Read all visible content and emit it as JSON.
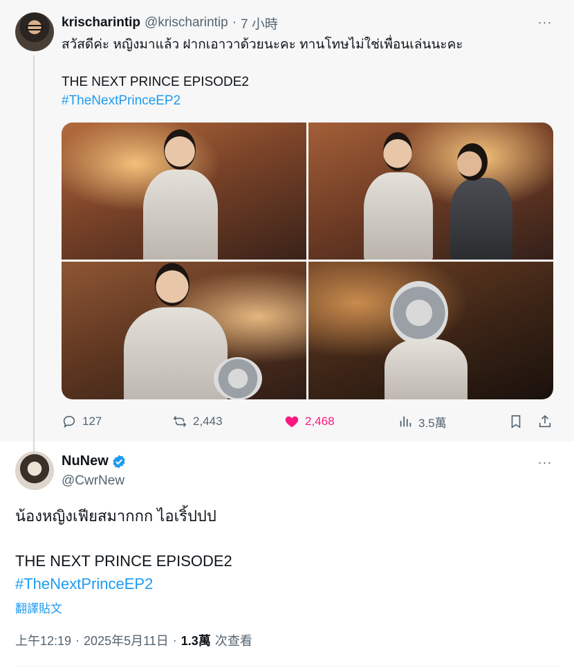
{
  "parent_tweet": {
    "display_name": "krischarintip",
    "handle": "@krischarintip",
    "separator": "·",
    "time": "7 小時",
    "text_line1": "สวัสดีค่ะ หญิงมาแล้ว ฝากเอาวาด้วยนะคะ ทานโทษไม่ใช่เพื่อนเล่นนะคะ",
    "text_line2": "THE NEXT PRINCE EPISODE2",
    "hashtag": "#TheNextPrinceEP2",
    "more_icon": "···",
    "stats": {
      "replies": "127",
      "reposts": "2,443",
      "likes": "2,468",
      "views": "3.5萬"
    },
    "like_color": "#f91880"
  },
  "main_tweet": {
    "display_name": "NuNew",
    "handle": "@CwrNew",
    "text_line1": "น้องหญิงเฟียสมากกก ไอเริ้ปปป",
    "text_line2": "THE NEXT PRINCE EPISODE2",
    "hashtag": "#TheNextPrinceEP2",
    "translate_label": "翻譯貼文",
    "time": "上午12:19",
    "separator": "·",
    "date": "2025年5月11日",
    "view_count": "1.3萬",
    "view_label": "次查看",
    "more_icon": "···"
  },
  "colors": {
    "link": "#1d9bf0",
    "secondary_text": "#536471",
    "parent_background": "#f7f7f7",
    "verified": "#1d9bf0"
  }
}
